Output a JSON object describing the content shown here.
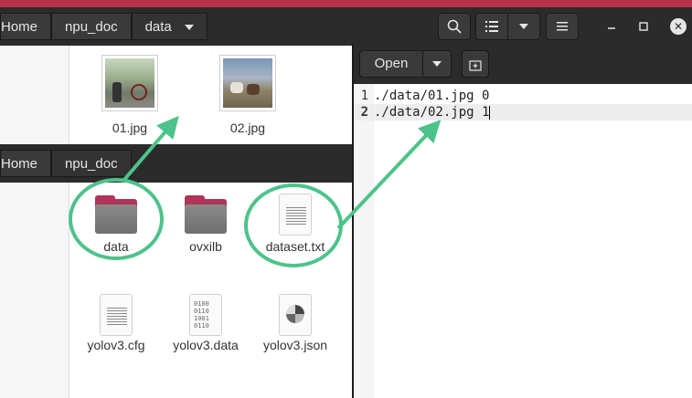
{
  "window1": {
    "breadcrumbs": [
      "Home",
      "npu_doc",
      "data"
    ],
    "files": [
      {
        "name": "01.jpg",
        "icon": "image-thumbnail-icon"
      },
      {
        "name": "02.jpg",
        "icon": "image-thumbnail-icon"
      }
    ]
  },
  "window2": {
    "breadcrumbs": [
      "Home",
      "npu_doc"
    ],
    "files": [
      {
        "name": "data",
        "icon": "folder-icon"
      },
      {
        "name": "ovxilb",
        "icon": "folder-icon"
      },
      {
        "name": "dataset.txt",
        "icon": "text-file-icon"
      },
      {
        "name": "yolov3.cfg",
        "icon": "text-file-icon"
      },
      {
        "name": "yolov3.data",
        "icon": "binary-file-icon"
      },
      {
        "name": "yolov3.json",
        "icon": "json-file-icon"
      }
    ],
    "binary_glyph": "0100\n0110\n1001\n0110"
  },
  "editor": {
    "open_label": "Open",
    "lines": [
      {
        "num": "1",
        "text": "./data/01.jpg 0"
      },
      {
        "num": "2",
        "text": "./data/02.jpg 1"
      }
    ]
  },
  "colors": {
    "accent_green": "#4cc38a",
    "folder_tab": "#b0355a",
    "header_dark": "#2b2b2b"
  }
}
